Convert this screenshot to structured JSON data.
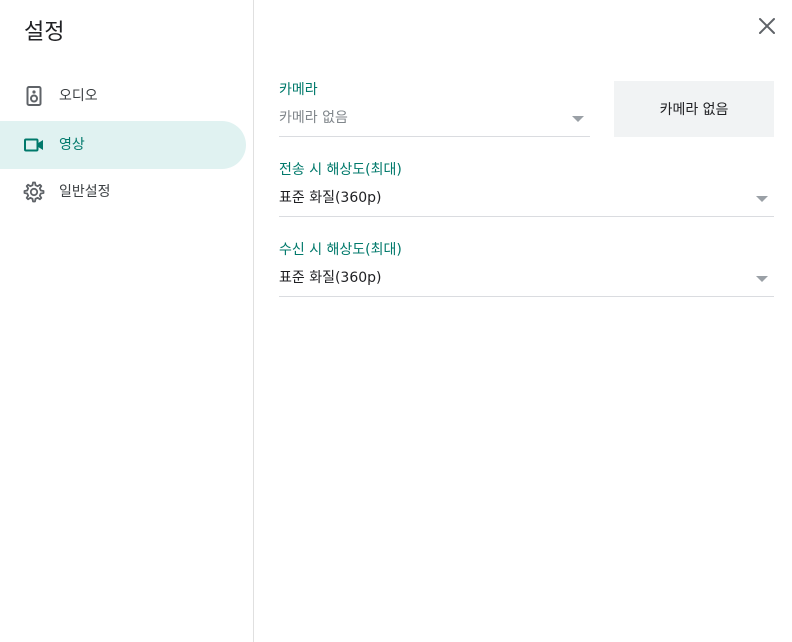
{
  "dialog": {
    "title": "설정",
    "close_icon": "close-icon"
  },
  "sidebar": {
    "items": [
      {
        "label": "오디오",
        "icon": "speaker-icon",
        "active": false
      },
      {
        "label": "영상",
        "icon": "videocam-icon",
        "active": true
      },
      {
        "label": "일반설정",
        "icon": "gear-icon",
        "active": false
      }
    ]
  },
  "video_settings": {
    "camera": {
      "label": "카메라",
      "value": "카메라 없음",
      "disabled": true
    },
    "preview": {
      "text": "카메라 없음"
    },
    "send_resolution": {
      "label": "전송 시 해상도(최대)",
      "value": "표준 화질(360p)"
    },
    "receive_resolution": {
      "label": "수신 시 해상도(최대)",
      "value": "표준 화질(360p)"
    }
  },
  "colors": {
    "accent": "#00796b",
    "active_bg": "#e0f2f1",
    "divider": "#dadce0"
  }
}
